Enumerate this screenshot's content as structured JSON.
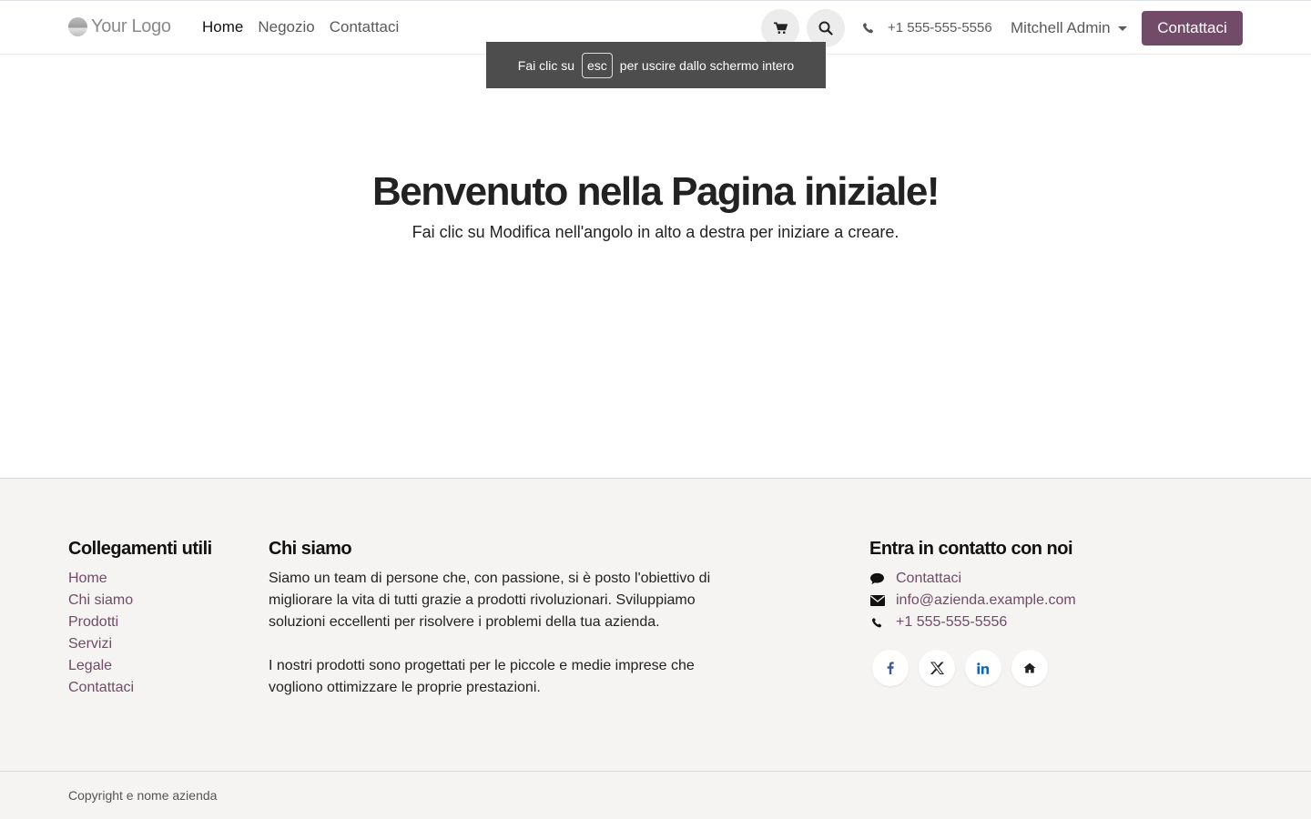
{
  "header": {
    "logo_text": "Your Logo",
    "nav": [
      {
        "label": "Home",
        "active": true
      },
      {
        "label": "Negozio",
        "active": false
      },
      {
        "label": "Contattaci",
        "active": false
      }
    ],
    "phone": "+1 555-555-5556",
    "user": "Mitchell Admin",
    "cta": "Contattaci"
  },
  "toast": {
    "before": "Fai clic su",
    "key": "esc",
    "after": "per uscire dallo schermo intero"
  },
  "hero": {
    "title_plain": "Benvenuto nella ",
    "title_bold": "Pagina iniziale",
    "title_end": "!",
    "subtitle": "Fai clic su Modifica nell'angolo in alto a destra per iniziare a creare."
  },
  "footer": {
    "links_title": "Collegamenti utili",
    "links": [
      "Home",
      "Chi siamo",
      "Prodotti",
      "Servizi",
      "Legale",
      "Contattaci"
    ],
    "about_title": "Chi siamo",
    "about_p1": "Siamo un team di persone che, con passione, si è posto l'obiettivo di migliorare la vita di tutti grazie a prodotti rivoluzionari. Sviluppiamo soluzioni eccellenti per risolvere i problemi della tua azienda.",
    "about_p2": "I nostri prodotti sono progettati per le piccole e medie imprese che vogliono ottimizzare le proprie prestazioni.",
    "contact_title": "Entra in contatto con noi",
    "contact_items": [
      {
        "icon": "comment-icon",
        "label": "Contattaci"
      },
      {
        "icon": "envelope-icon",
        "label": "info@azienda.example.com"
      },
      {
        "icon": "phone-icon",
        "label": "+1 555-555-5556"
      }
    ],
    "socials": [
      "facebook-icon",
      "x-twitter-icon",
      "linkedin-icon",
      "home-icon"
    ],
    "copyright": "Copyright e nome azienda"
  },
  "colors": {
    "brand": "#714b67",
    "footer_bg": "#f5f4f2",
    "linkedin": "#0a66c2",
    "facebook": "#3b5998"
  }
}
